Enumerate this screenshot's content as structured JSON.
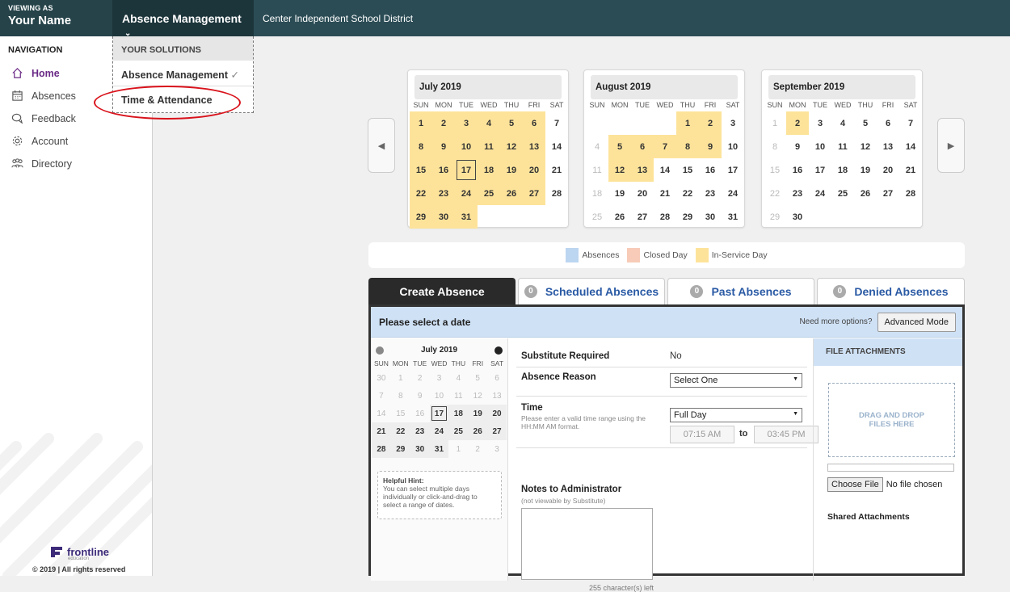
{
  "header": {
    "viewing_as_label": "VIEWING AS",
    "user_name": "Your Name",
    "product": "Absence Management",
    "org": "Center Independent School District"
  },
  "dropdown": {
    "heading": "YOUR SOLUTIONS",
    "items": [
      {
        "label": "Absence Management",
        "check": "✓"
      },
      {
        "label": "Time & Attendance"
      }
    ]
  },
  "sidebar": {
    "title": "NAVIGATION",
    "items": [
      {
        "label": "Home",
        "icon": "home-icon"
      },
      {
        "label": "Absences",
        "icon": "calendar-icon"
      },
      {
        "label": "Feedback",
        "icon": "chat-icon"
      },
      {
        "label": "Account",
        "icon": "gear-icon"
      },
      {
        "label": "Directory",
        "icon": "people-icon"
      }
    ],
    "logo_text": "frontline",
    "logo_sub": "education",
    "copyright": "© 2019 | All rights reserved"
  },
  "weekdays": [
    "SUN",
    "MON",
    "TUE",
    "WED",
    "THU",
    "FRI",
    "SAT"
  ],
  "calendars": [
    {
      "title": "July 2019",
      "lead": 0,
      "days": 31,
      "inservice": [
        1,
        2,
        3,
        4,
        5,
        6,
        8,
        9,
        10,
        11,
        12,
        13,
        15,
        16,
        17,
        18,
        19,
        20,
        22,
        23,
        24,
        25,
        26,
        27,
        29,
        30,
        31
      ],
      "today": 17
    },
    {
      "title": "August 2019",
      "lead": 4,
      "days": 31,
      "inservice": [
        1,
        2,
        5,
        6,
        7,
        8,
        9,
        12,
        13
      ],
      "today": null
    },
    {
      "title": "September 2019",
      "lead": 0,
      "days": 30,
      "inservice": [
        2
      ],
      "today": null
    }
  ],
  "legend": [
    {
      "label": "Absences",
      "color": "#bcd6f1"
    },
    {
      "label": "Closed Day",
      "color": "#f7cbb8"
    },
    {
      "label": "In-Service Day",
      "color": "#fde39a"
    }
  ],
  "tabs": [
    {
      "label": "Create Absence",
      "count": ""
    },
    {
      "label": "Scheduled Absences",
      "count": "0"
    },
    {
      "label": "Past Absences",
      "count": "0"
    },
    {
      "label": "Denied Absences",
      "count": "0"
    }
  ],
  "panel": {
    "prompt": "Please select a date",
    "more_options": "Need more options?",
    "advanced_button": "Advanced Mode"
  },
  "mini_cal": {
    "title": "July 2019",
    "cells": [
      30,
      1,
      2,
      3,
      4,
      5,
      6,
      7,
      8,
      9,
      10,
      11,
      12,
      13,
      14,
      15,
      16,
      17,
      18,
      19,
      20,
      21,
      22,
      23,
      24,
      25,
      26,
      27,
      28,
      29,
      30,
      31,
      1,
      2,
      3
    ],
    "active_from": 17,
    "active_to_index": 34,
    "today": 17
  },
  "hint": {
    "title": "Helpful Hint:",
    "text": "You can select multiple days individually or click-and-drag to select a range of dates."
  },
  "form": {
    "sub_required_label": "Substitute Required",
    "sub_required_value": "No",
    "reason_label": "Absence Reason",
    "reason_value": "Select One",
    "time_label": "Time",
    "time_help": "Please enter a valid time range using the HH:MM AM format.",
    "time_value": "Full Day",
    "start_time": "07:15 AM",
    "to_label": "to",
    "end_time": "03:45 PM",
    "notes_label": "Notes to Administrator",
    "notes_sub": "(not viewable by Substitute)",
    "chars_left": "255 character(s) left"
  },
  "attachments": {
    "heading": "FILE ATTACHMENTS",
    "drop_text": "DRAG AND DROP FILES HERE",
    "choose_button": "Choose File",
    "no_file": "No file chosen",
    "shared": "Shared Attachments"
  }
}
